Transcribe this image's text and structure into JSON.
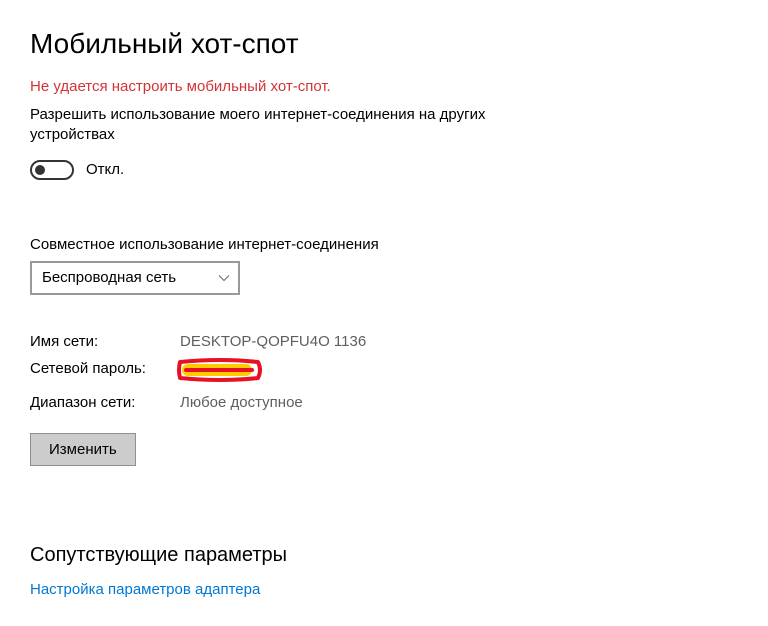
{
  "title": "Мобильный хот-спот",
  "error": "Не удается настроить мобильный хот-спот.",
  "share_description": "Разрешить использование моего интернет-соединения на других устройствах",
  "toggle_state_label": "Откл.",
  "connection_share_label": "Совместное использование интернет-соединения",
  "connection_select_value": "Беспроводная сеть",
  "network": {
    "name_label": "Имя сети:",
    "name_value": "DESKTOP-QOPFU4O 1136",
    "password_label": "Сетевой пароль:",
    "band_label": "Диапазон сети:",
    "band_value": "Любое доступное"
  },
  "edit_button": "Изменить",
  "related": {
    "title": "Сопутствующие параметры",
    "adapter_link": "Настройка параметров адаптера"
  }
}
